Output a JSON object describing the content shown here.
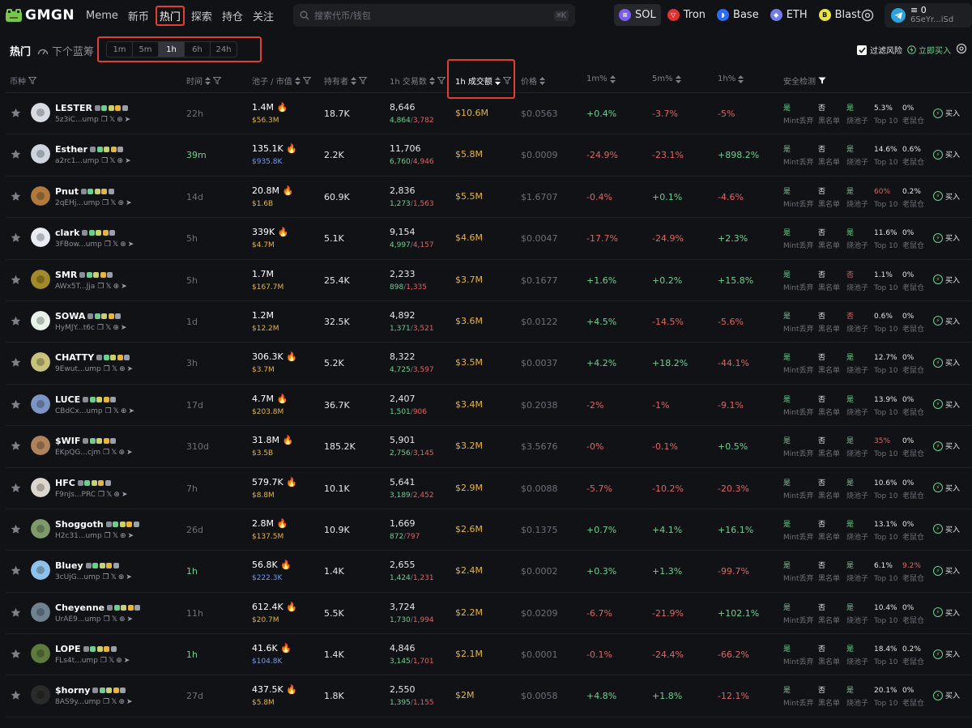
{
  "brand": {
    "name": "GMGN"
  },
  "nav": [
    {
      "label": "Meme",
      "active": false
    },
    {
      "label": "新币",
      "active": false
    },
    {
      "label": "热门",
      "active": true
    },
    {
      "label": "探索",
      "active": false
    },
    {
      "label": "持仓",
      "active": false
    },
    {
      "label": "关注",
      "active": false
    }
  ],
  "search": {
    "placeholder": "搜索代币/钱包",
    "shortcut": "⌘K"
  },
  "chains": [
    {
      "label": "SOL",
      "active": true,
      "color": "#7c5cf5"
    },
    {
      "label": "Tron",
      "active": false,
      "color": "#e0302f"
    },
    {
      "label": "Base",
      "active": false,
      "color": "#2b6cf6"
    },
    {
      "label": "ETH",
      "active": false,
      "color": "#6f7ee8"
    },
    {
      "label": "Blast",
      "active": false,
      "color": "#e9e43a"
    }
  ],
  "wallet": {
    "balance": "0",
    "address": "6SeYr...iSd"
  },
  "subbar": {
    "title": "热门",
    "next": "下个蓝筹",
    "timeframes": [
      {
        "label": "1m",
        "active": false
      },
      {
        "label": "5m",
        "active": false
      },
      {
        "label": "1h",
        "active": true
      },
      {
        "label": "6h",
        "active": false
      },
      {
        "label": "24h",
        "active": false
      }
    ],
    "filter_risk": "过滤风险",
    "buy_now": "立即买入"
  },
  "columns": {
    "token": "币种",
    "age": "时间",
    "pool": "池子 / 市值",
    "holders": "持有者",
    "tx": "1h 交易数",
    "volume": "1h 成交额",
    "price": "价格",
    "c1m": "1m%",
    "c5m": "5m%",
    "c1h": "1h%",
    "security": "安全检测"
  },
  "security_labels": [
    "Mint丢弃",
    "黑名单",
    "烧池子",
    "Top 10",
    "老鼠仓"
  ],
  "buy_label": "买入",
  "rows": [
    {
      "name": "LESTER",
      "addr": "5z3iC...ump",
      "age": "22h",
      "fresh": false,
      "pool": "1.4M",
      "fire": true,
      "mcap": "$56.3M",
      "mcapBlue": false,
      "holders": "18.7K",
      "tx": "8,646",
      "buys": "4,864",
      "sells": "3,782",
      "vol": "$10.6M",
      "price": "$0.0563",
      "c1m": "+0.4%",
      "c5m": "-3.7%",
      "c1h": "-5%",
      "s1": "是",
      "s2": "否",
      "s3": "是",
      "s4": "5.3%",
      "s5": "0%",
      "s3bad": false,
      "s4bad": false,
      "s5bad": false,
      "avatar": "#d7dbe2"
    },
    {
      "name": "Esther",
      "addr": "a2rc1...ump",
      "age": "39m",
      "fresh": true,
      "pool": "135.1K",
      "fire": true,
      "mcap": "$935.8K",
      "mcapBlue": true,
      "holders": "2.2K",
      "tx": "11,706",
      "buys": "6,760",
      "sells": "4,946",
      "vol": "$5.8M",
      "price": "$0.0009",
      "c1m": "-24.9%",
      "c5m": "-23.1%",
      "c1h": "+898.2%",
      "s1": "是",
      "s2": "否",
      "s3": "是",
      "s4": "14.6%",
      "s5": "0.6%",
      "s3bad": false,
      "s4bad": false,
      "s5bad": false,
      "avatar": "#cfd5de"
    },
    {
      "name": "Pnut",
      "addr": "2qEHj...ump",
      "age": "14d",
      "fresh": false,
      "pool": "20.8M",
      "fire": true,
      "mcap": "$1.6B",
      "mcapBlue": false,
      "holders": "60.9K",
      "tx": "2,836",
      "buys": "1,273",
      "sells": "1,563",
      "vol": "$5.5M",
      "price": "$1.6707",
      "c1m": "-0.4%",
      "c5m": "+0.1%",
      "c1h": "-4.6%",
      "s1": "是",
      "s2": "否",
      "s3": "是",
      "s4": "60%",
      "s5": "0.2%",
      "s3bad": false,
      "s4bad": true,
      "s5bad": false,
      "avatar": "#b07a3e"
    },
    {
      "name": "clark",
      "addr": "3FBow...ump",
      "age": "5h",
      "fresh": false,
      "pool": "339K",
      "fire": true,
      "mcap": "$4.7M",
      "mcapBlue": false,
      "holders": "5.1K",
      "tx": "9,154",
      "buys": "4,997",
      "sells": "4,157",
      "vol": "$4.6M",
      "price": "$0.0047",
      "c1m": "-17.7%",
      "c5m": "-24.9%",
      "c1h": "+2.3%",
      "s1": "是",
      "s2": "否",
      "s3": "是",
      "s4": "11.6%",
      "s5": "0%",
      "s3bad": false,
      "s4bad": false,
      "s5bad": false,
      "avatar": "#e8ecf3"
    },
    {
      "name": "SMR",
      "addr": "AWx5T...Jja",
      "age": "5h",
      "fresh": false,
      "pool": "1.7M",
      "fire": false,
      "mcap": "$167.7M",
      "mcapBlue": false,
      "holders": "25.4K",
      "tx": "2,233",
      "buys": "898",
      "sells": "1,335",
      "vol": "$3.7M",
      "price": "$0.1677",
      "c1m": "+1.6%",
      "c5m": "+0.2%",
      "c1h": "+15.8%",
      "s1": "是",
      "s2": "否",
      "s3": "否",
      "s4": "1.1%",
      "s5": "0%",
      "s3bad": true,
      "s4bad": false,
      "s5bad": false,
      "avatar": "#a28a2a"
    },
    {
      "name": "SOWA",
      "addr": "HyMJY...t6c",
      "age": "1d",
      "fresh": false,
      "pool": "1.2M",
      "fire": false,
      "mcap": "$12.2M",
      "mcapBlue": false,
      "holders": "32.5K",
      "tx": "4,892",
      "buys": "1,371",
      "sells": "3,521",
      "vol": "$3.6M",
      "price": "$0.0122",
      "c1m": "+4.5%",
      "c5m": "-14.5%",
      "c1h": "-5.6%",
      "s1": "是",
      "s2": "否",
      "s3": "否",
      "s4": "0.6%",
      "s5": "0%",
      "s3bad": true,
      "s4bad": false,
      "s5bad": false,
      "avatar": "#e9f3ea"
    },
    {
      "name": "CHATTY",
      "addr": "9Ewut...ump",
      "age": "3h",
      "fresh": false,
      "pool": "306.3K",
      "fire": true,
      "mcap": "$3.7M",
      "mcapBlue": false,
      "holders": "5.2K",
      "tx": "8,322",
      "buys": "4,725",
      "sells": "3,597",
      "vol": "$3.5M",
      "price": "$0.0037",
      "c1m": "+4.2%",
      "c5m": "+18.2%",
      "c1h": "-44.1%",
      "s1": "是",
      "s2": "否",
      "s3": "是",
      "s4": "12.7%",
      "s5": "0%",
      "s3bad": false,
      "s4bad": false,
      "s5bad": false,
      "avatar": "#c9c27a"
    },
    {
      "name": "LUCE",
      "addr": "CBdCx...ump",
      "age": "17d",
      "fresh": false,
      "pool": "4.7M",
      "fire": true,
      "mcap": "$203.8M",
      "mcapBlue": false,
      "holders": "36.7K",
      "tx": "2,407",
      "buys": "1,501",
      "sells": "906",
      "vol": "$3.4M",
      "price": "$0.2038",
      "c1m": "-2%",
      "c5m": "-1%",
      "c1h": "-9.1%",
      "s1": "是",
      "s2": "否",
      "s3": "是",
      "s4": "13.9%",
      "s5": "0%",
      "s3bad": false,
      "s4bad": false,
      "s5bad": false,
      "avatar": "#7c95c5"
    },
    {
      "name": "$WIF",
      "addr": "EKpQG...cjm",
      "age": "310d",
      "fresh": false,
      "pool": "31.8M",
      "fire": true,
      "mcap": "$3.5B",
      "mcapBlue": false,
      "holders": "185.2K",
      "tx": "5,901",
      "buys": "2,756",
      "sells": "3,145",
      "vol": "$3.2M",
      "price": "$3.5676",
      "c1m": "-0%",
      "c5m": "-0.1%",
      "c1h": "+0.5%",
      "s1": "是",
      "s2": "否",
      "s3": "是",
      "s4": "35%",
      "s5": "0%",
      "s3bad": false,
      "s4bad": true,
      "s5bad": false,
      "avatar": "#b0835c"
    },
    {
      "name": "HFC",
      "addr": "F9nJs...PRC",
      "age": "7h",
      "fresh": false,
      "pool": "579.7K",
      "fire": true,
      "mcap": "$8.8M",
      "mcapBlue": false,
      "holders": "10.1K",
      "tx": "5,641",
      "buys": "3,189",
      "sells": "2,452",
      "vol": "$2.9M",
      "price": "$0.0088",
      "c1m": "-5.7%",
      "c5m": "-10.2%",
      "c1h": "-20.3%",
      "s1": "是",
      "s2": "否",
      "s3": "是",
      "s4": "10.6%",
      "s5": "0%",
      "s3bad": false,
      "s4bad": false,
      "s5bad": false,
      "avatar": "#dcd7ce"
    },
    {
      "name": "Shoggoth",
      "addr": "H2c31...ump",
      "age": "26d",
      "fresh": false,
      "pool": "2.8M",
      "fire": true,
      "mcap": "$137.5M",
      "mcapBlue": false,
      "holders": "10.9K",
      "tx": "1,669",
      "buys": "872",
      "sells": "797",
      "vol": "$2.6M",
      "price": "$0.1375",
      "c1m": "+0.7%",
      "c5m": "+4.1%",
      "c1h": "+16.1%",
      "s1": "是",
      "s2": "否",
      "s3": "是",
      "s4": "13.1%",
      "s5": "0%",
      "s3bad": false,
      "s4bad": false,
      "s5bad": false,
      "avatar": "#7f9a6a"
    },
    {
      "name": "Bluey",
      "addr": "3cUjG...ump",
      "age": "1h",
      "fresh": true,
      "pool": "56.8K",
      "fire": true,
      "mcap": "$222.3K",
      "mcapBlue": true,
      "holders": "1.4K",
      "tx": "2,655",
      "buys": "1,424",
      "sells": "1,231",
      "vol": "$2.4M",
      "price": "$0.0002",
      "c1m": "+0.3%",
      "c5m": "+1.3%",
      "c1h": "-99.7%",
      "s1": "是",
      "s2": "否",
      "s3": "是",
      "s4": "6.1%",
      "s5": "9.2%",
      "s3bad": false,
      "s4bad": false,
      "s5bad": true,
      "avatar": "#8fc2ea"
    },
    {
      "name": "Cheyenne",
      "addr": "UrAE9...ump",
      "age": "11h",
      "fresh": false,
      "pool": "612.4K",
      "fire": true,
      "mcap": "$20.7M",
      "mcapBlue": false,
      "holders": "5.5K",
      "tx": "3,724",
      "buys": "1,730",
      "sells": "1,994",
      "vol": "$2.2M",
      "price": "$0.0209",
      "c1m": "-6.7%",
      "c5m": "-21.9%",
      "c1h": "+102.1%",
      "s1": "是",
      "s2": "否",
      "s3": "是",
      "s4": "10.4%",
      "s5": "0%",
      "s3bad": false,
      "s4bad": false,
      "s5bad": false,
      "avatar": "#6f8292"
    },
    {
      "name": "LOPE",
      "addr": "FLs4t...ump",
      "age": "1h",
      "fresh": true,
      "pool": "41.6K",
      "fire": true,
      "mcap": "$104.8K",
      "mcapBlue": true,
      "holders": "1.4K",
      "tx": "4,846",
      "buys": "3,145",
      "sells": "1,701",
      "vol": "$2.1M",
      "price": "$0.0001",
      "c1m": "-0.1%",
      "c5m": "-24.4%",
      "c1h": "-66.2%",
      "s1": "是",
      "s2": "否",
      "s3": "是",
      "s4": "18.4%",
      "s5": "0.2%",
      "s3bad": false,
      "s4bad": false,
      "s5bad": false,
      "avatar": "#5f7a3d"
    },
    {
      "name": "$horny",
      "addr": "8AS9y...ump",
      "age": "27d",
      "fresh": false,
      "pool": "437.5K",
      "fire": true,
      "mcap": "$5.8M",
      "mcapBlue": false,
      "holders": "1.8K",
      "tx": "2,550",
      "buys": "1,395",
      "sells": "1,155",
      "vol": "$2M",
      "price": "$0.0058",
      "c1m": "+4.8%",
      "c5m": "+1.8%",
      "c1h": "-12.1%",
      "s1": "是",
      "s2": "否",
      "s3": "是",
      "s4": "20.1%",
      "s5": "0%",
      "s3bad": false,
      "s4bad": false,
      "s5bad": false,
      "avatar": "#2a2a2a"
    }
  ]
}
